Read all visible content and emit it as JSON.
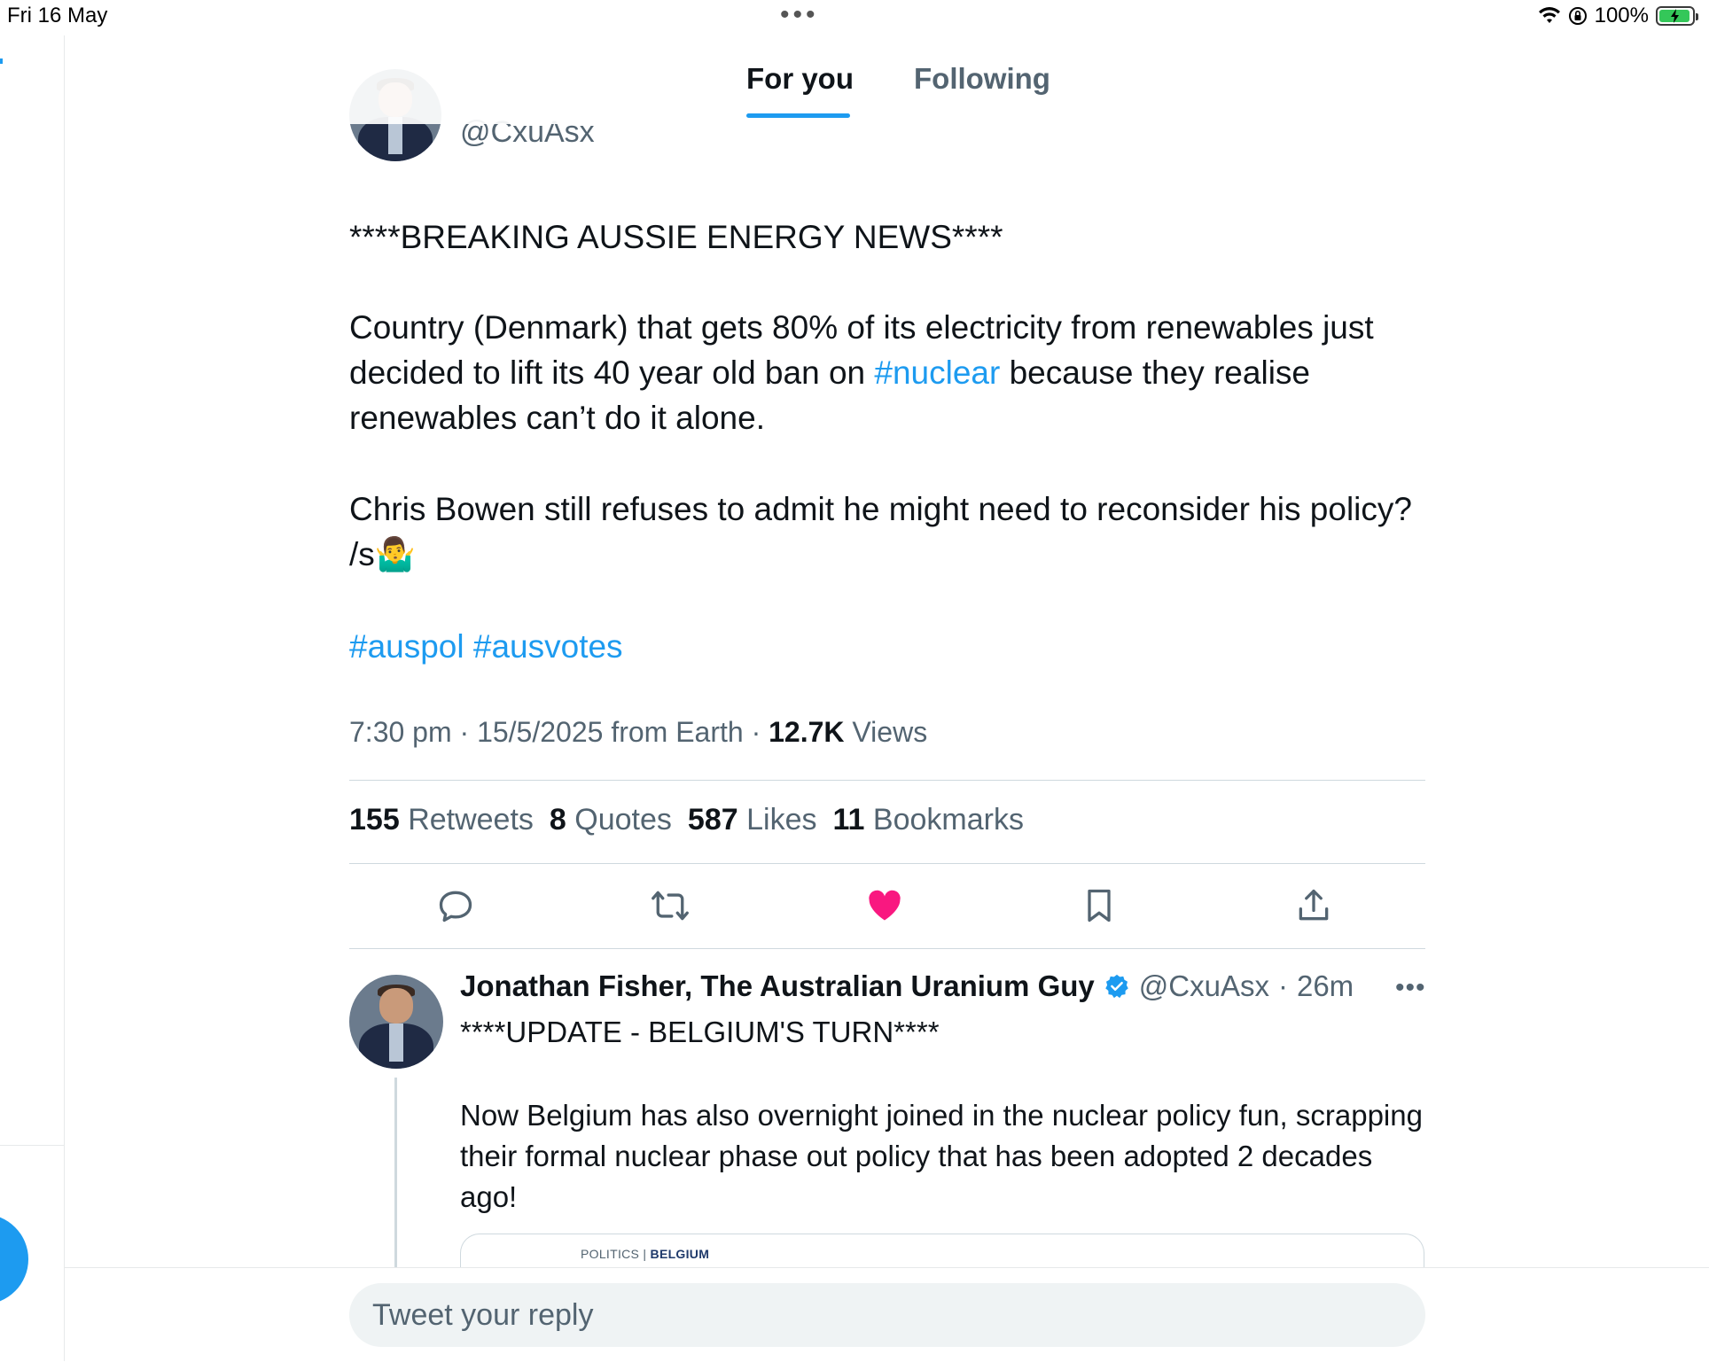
{
  "status_bar": {
    "date": "Fri 16 May",
    "battery": "100%"
  },
  "tabs": [
    {
      "label": "For you",
      "active": true
    },
    {
      "label": "Following",
      "active": false
    }
  ],
  "tweet": {
    "handle": "@CxuAsx",
    "headline": "****BREAKING AUSSIE ENERGY NEWS****",
    "para1_before": "Country (Denmark) that gets 80% of its electricity from renewables just decided to lift its 40 year old ban on ",
    "para1_link": "#nuclear",
    "para1_after": " because they realise renewables can’t do it alone.",
    "para2": "Chris Bowen still refuses to admit he might need to reconsider his policy? /s",
    "emoji": "🤷‍♂️",
    "hashtag1": "#auspol",
    "hashtag2": "#ausvotes",
    "time": "7:30 pm",
    "date": "15/5/2025",
    "source": "from Earth",
    "views_count": "12.7K",
    "views_label": "Views",
    "stats": {
      "retweets_count": "155",
      "retweets_label": "Retweets",
      "quotes_count": "8",
      "quotes_label": "Quotes",
      "likes_count": "587",
      "likes_label": "Likes",
      "bookmarks_count": "11",
      "bookmarks_label": "Bookmarks"
    },
    "liked": true,
    "colors": {
      "accent": "#1d9bf0",
      "like": "#f91880"
    }
  },
  "reply": {
    "name": "Jonathan Fisher, The Australian Uranium Guy",
    "handle": "@CxuAsx",
    "time": "26m",
    "headline": "****UPDATE - BELGIUM'S TURN****",
    "body": "Now Belgium has also overnight joined in the nuclear policy fun, scrapping their formal nuclear phase out policy that has been adopted 2 decades ago!",
    "card_section": "POLITICS",
    "card_region": "BELGIUM"
  },
  "reply_bar": {
    "placeholder": "Tweet your reply"
  },
  "icons": [
    "wifi-icon",
    "orientation-lock-icon",
    "battery-icon",
    "reply-icon",
    "retweet-icon",
    "like-icon",
    "bookmark-icon",
    "share-icon",
    "verified-badge-icon",
    "more-icon"
  ]
}
